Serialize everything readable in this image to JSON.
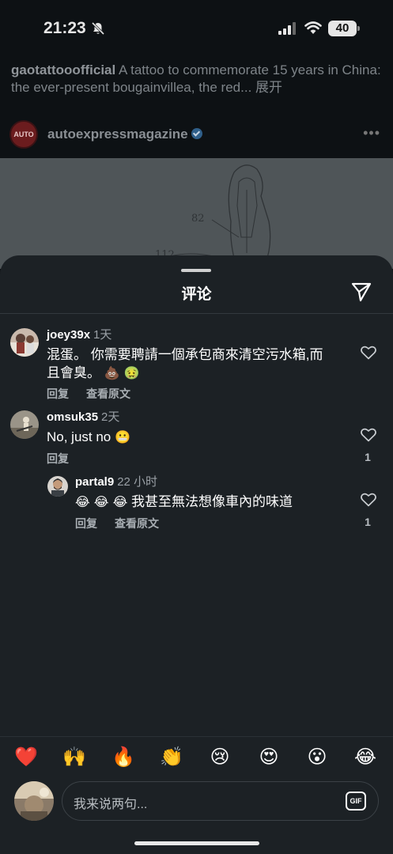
{
  "status_bar": {
    "time": "21:23",
    "battery": "40",
    "icons": [
      "bell-slash-icon",
      "signal-icon",
      "wifi-icon",
      "battery-icon"
    ]
  },
  "feed": {
    "previous_caption": {
      "user": "gaotattooofficial",
      "text": " A tattoo to commemorate 15 years in China: the ever-present bougainvillea, the red...",
      "more": "展开"
    },
    "post": {
      "avatar_text": "AUTO",
      "user": "autoexpressmagazine",
      "verified": true,
      "more_icon": "more-horizontal-icon",
      "image_labels": [
        "82",
        "112"
      ]
    }
  },
  "sheet": {
    "title": "评论",
    "share_icon": "send-icon"
  },
  "comments": [
    {
      "user": "joey39x",
      "time": "1天",
      "text_line1": "混蛋。 你需要聘請一個承包商來清空污水箱,而",
      "text_line2": "且會臭。",
      "emojis": "💩 🤢",
      "actions": [
        "回复",
        "查看原文"
      ],
      "likes": ""
    },
    {
      "user": "omsuk35",
      "time": "2天",
      "text_line1": "No, just no",
      "emojis": "😬",
      "actions": [
        "回复"
      ],
      "likes": "1"
    },
    {
      "user": "partal9",
      "time": "22 小时",
      "emojis": "😂 😂 😂",
      "text_line1": "我甚至無法想像車內的味道",
      "actions": [
        "回复",
        "查看原文"
      ],
      "likes": "1"
    }
  ],
  "reactions": [
    "❤️",
    "🙌",
    "🔥",
    "👏",
    "😢",
    "😍",
    "😮",
    "😂"
  ],
  "composer": {
    "placeholder": "我来说两句...",
    "gif_label": "GIF"
  },
  "colors": {
    "sheet_bg": "#1c2125",
    "feed_bg": "#0d1114",
    "heart": "#ff3040"
  }
}
